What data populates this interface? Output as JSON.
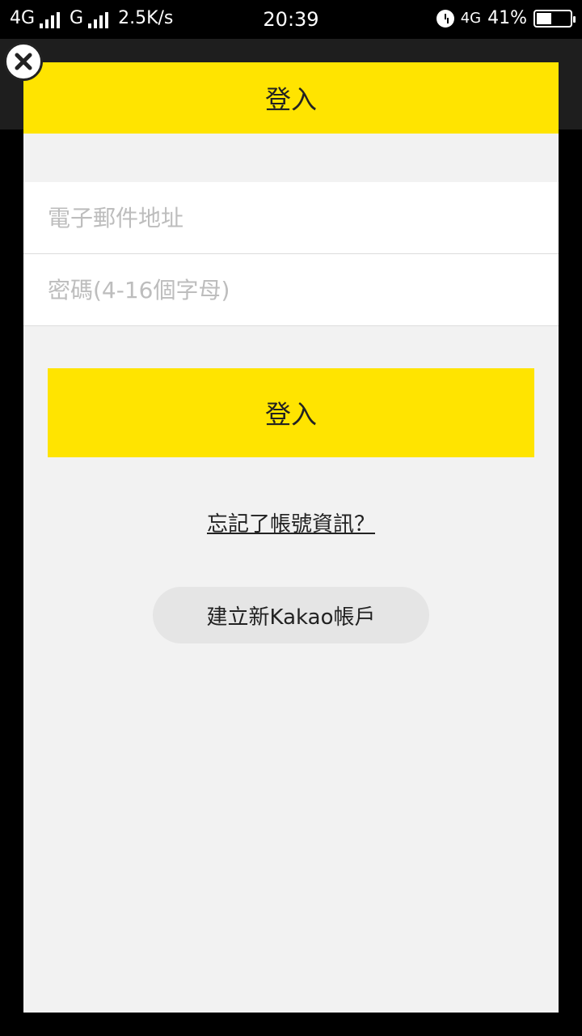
{
  "status_bar": {
    "network_left": "4G",
    "network_right": "G",
    "speed": "2.5K/s",
    "time": "20:39",
    "network_status": "4G",
    "battery": "41%"
  },
  "modal": {
    "title": "登入",
    "email_placeholder": "電子郵件地址",
    "password_placeholder": "密碼(4-16個字母)",
    "login_label": "登入",
    "forgot_label": "忘記了帳號資訊？",
    "create_label": "建立新Kakao帳戶"
  },
  "icons": {
    "close": "close-icon",
    "alarm": "alarm-icon",
    "battery": "battery-icon"
  },
  "colors": {
    "accent": "#ffe400",
    "background": "#f2f2f2"
  }
}
